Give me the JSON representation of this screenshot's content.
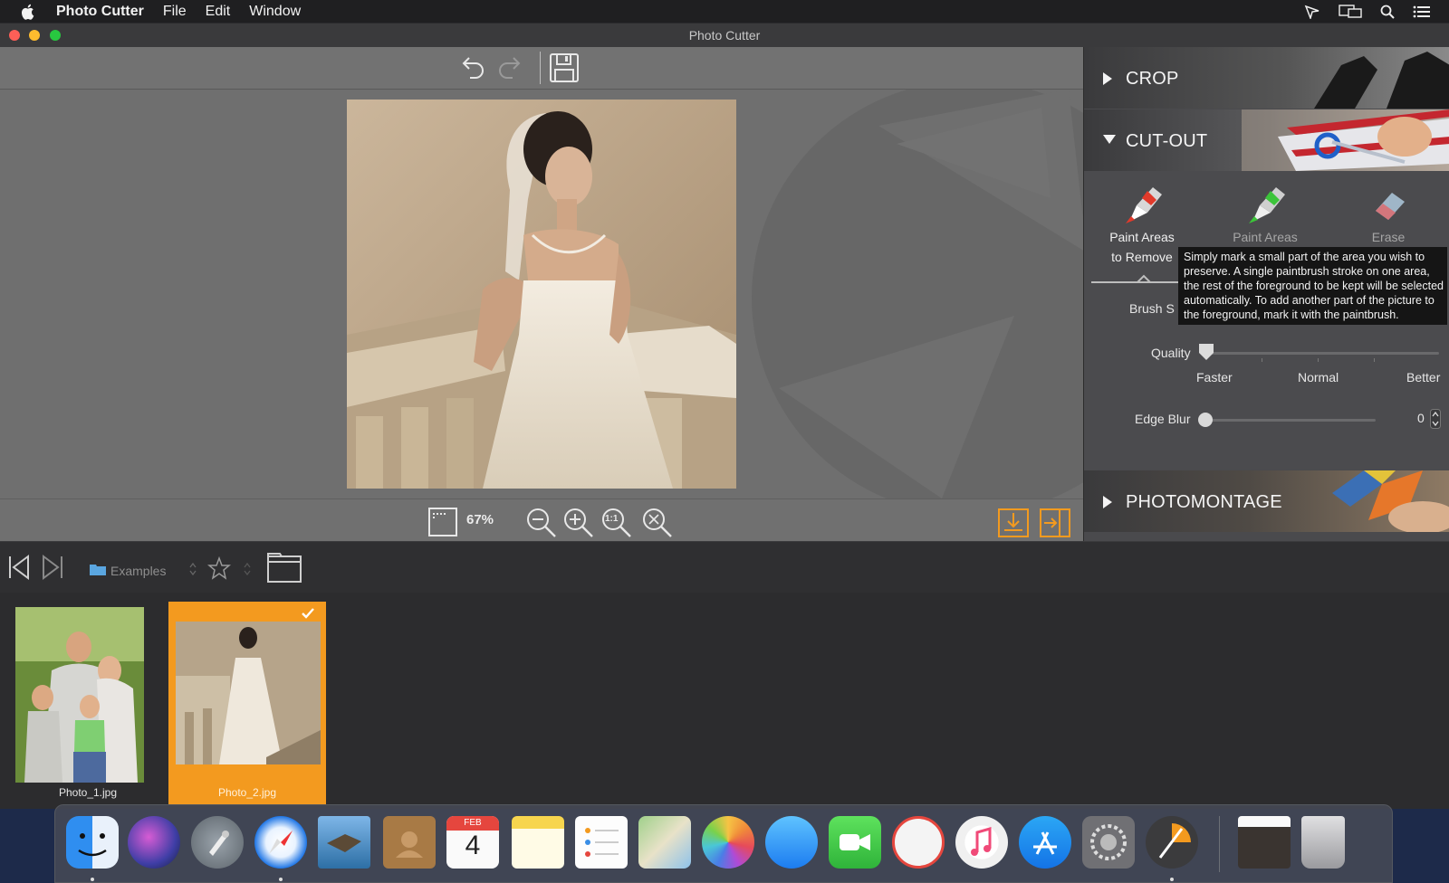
{
  "menubar": {
    "app_name": "Photo Cutter",
    "menus": [
      "File",
      "Edit",
      "Window"
    ]
  },
  "window": {
    "title": "Photo Cutter"
  },
  "zoom": {
    "value": "67%",
    "one_to_one": "1:1"
  },
  "panel": {
    "crop_label": "CROP",
    "cutout_label": "CUT-OUT",
    "photomontage_label": "PHOTOMONTAGE",
    "tools": [
      {
        "label_line1": "Paint Areas",
        "label_line2": "to Remove"
      },
      {
        "label_line1": "Paint Areas",
        "label_line2": ""
      },
      {
        "label_line1": "Erase",
        "label_line2": ""
      }
    ],
    "brush_size_label": "Brush S",
    "tooltip": "Simply mark a small part of the area you wish to preserve. A single paintbrush stroke on one area, the rest of the foreground to be kept will be selected automatically. To add another part of the picture to the foreground, mark it with the paintbrush.",
    "quality_label": "Quality",
    "quality_levels": [
      "Faster",
      "Normal",
      "Better"
    ],
    "quality_level_value": 0,
    "edge_blur_label": "Edge Blur",
    "edge_blur_value": "0"
  },
  "browser": {
    "folder": "Examples",
    "thumbnails": [
      {
        "name": "Photo_1.jpg",
        "selected": false
      },
      {
        "name": "Photo_2.jpg",
        "selected": true
      }
    ]
  },
  "dock": {
    "feb_label": "FEB",
    "date_number": "4",
    "items": [
      "finder-icon",
      "siri-icon",
      "launchpad-icon",
      "safari-icon",
      "mail-icon",
      "contacts-icon",
      "calendar-icon",
      "notes-icon",
      "reminders-icon",
      "maps-icon",
      "photos-icon",
      "messages-icon",
      "facetime-icon",
      "news-icon",
      "music-icon",
      "app-store-icon",
      "system-preferences-icon",
      "photo-cutter-icon",
      "downloads-stack-icon",
      "trash-icon"
    ]
  },
  "colors": {
    "accent": "#f39a1f",
    "panel_bg": "#4b4b4e",
    "canvas_bg": "#6f6f6f"
  }
}
